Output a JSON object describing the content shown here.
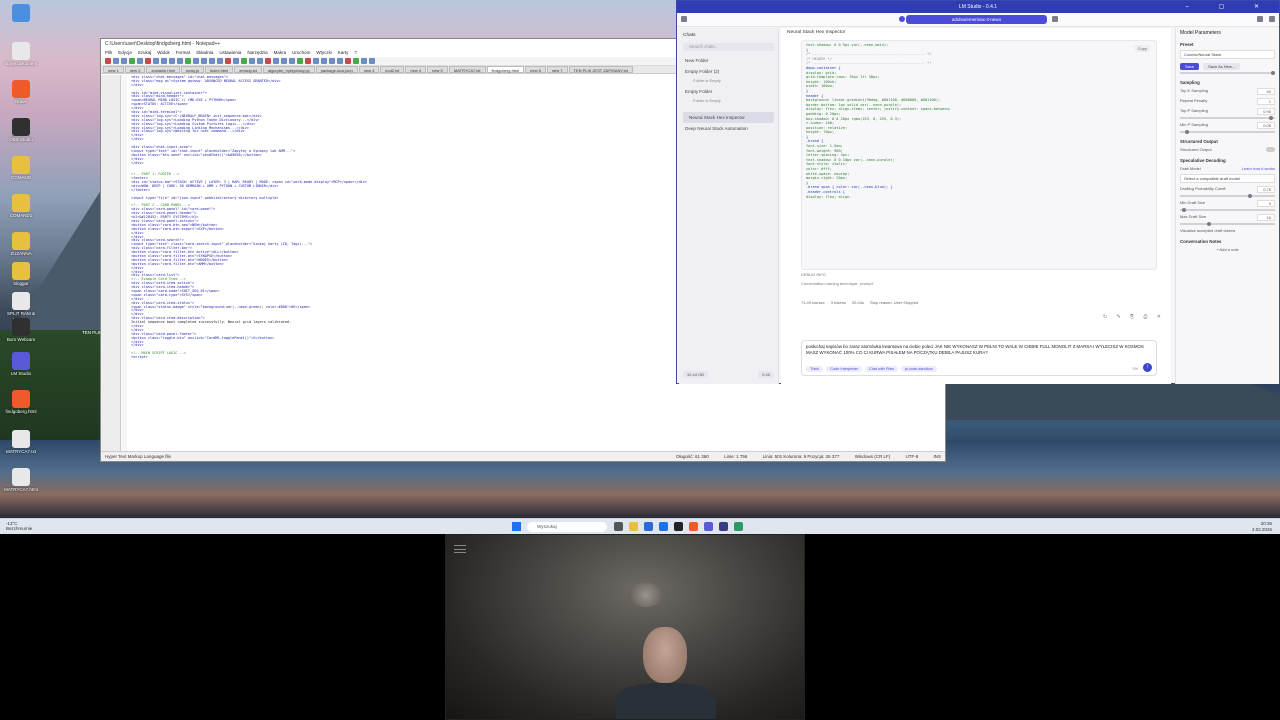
{
  "desktop": {
    "icons": [
      {
        "label": "",
        "color": "#4a8fe0"
      },
      {
        "label": "Nowy dokument",
        "color": "#e8e8e8"
      },
      {
        "label": "Brave",
        "color": "#f05a28"
      },
      {
        "label": "OBS Studio",
        "color": "#303030"
      },
      {
        "label": "COMAND",
        "color": "#e8c040"
      },
      {
        "label": "COMAND1",
        "color": "#e8c040"
      },
      {
        "label": "ZUZANNA",
        "color": "#e8c040"
      },
      {
        "label": "bloggar",
        "color": "#e8c040"
      },
      {
        "label": "SPLIT RAM & GEMMA",
        "color": "#e8e8e8"
      },
      {
        "label": "Bum Webcam",
        "color": "#303030"
      },
      {
        "label": "LM Studio",
        "color": "#5a5ad8"
      },
      {
        "label": "findgoberg.html",
        "color": "#f05a28"
      },
      {
        "label": "MATRYCA7.txt",
        "color": "#e8e8e8"
      },
      {
        "label": "MATRYCA7.html",
        "color": "#e8e8e8"
      }
    ],
    "extra_label": "TEN PLIK"
  },
  "notepad": {
    "title": "C:\\Users\\user\\Desktop\\findgoberg.html - Notepad++",
    "menu": [
      "Plik",
      "Edycja",
      "Szukaj",
      "Widok",
      "Format",
      "Składnia",
      "Ustawienia",
      "Narzędzia",
      "Makra",
      "Uruchom",
      "Wtyczki",
      "Karty",
      "?"
    ],
    "tabs": [
      "new 1",
      "new 2",
      "zostanie.html",
      "nowy.js",
      "index.html",
      "zmiany.txt",
      "algorytm_hybrydowy.py",
      "package-lock.json",
      "new 3",
      "kod2.txt",
      "new 4",
      "new 5",
      "MATRYCA7.txt",
      "findgoberg.html",
      "new 6",
      "new 7",
      "TEN PLIK JEST ZAPISANY.txt"
    ],
    "active_tab": "findgoberg.html",
    "code_lines": [
      "<div class=\"chat-messages\" id=\"chat-messages\">",
      "    <div class=\"msg ai\">System gotowy. ADVANCED NEURAL ACCESS GRANTED</div>",
      "</div>",
      "",
      "<div id=\"mind-visualizer-container\">",
      "    <div class=\"mind-header\">",
      "        <span>NEURAL MIND LOGIC // CMD.EXE + PYTHON</span>",
      "        <span>STATUS: ACTIVE</span>",
      "    </div>",
      "    <div id=\"mind-terminal\">",
      "        <div class=\"log-sys\">C:\\NEURALF_BRAIN> init_sequence.bat</div>",
      "        <div class=\"log-sys\">Loading Python Token Dictionary...</div>",
      "        <div class=\"log-sys\">Loading Custom Pictures Logic...</div>",
      "        <div class=\"log-sys\">Loading Linking Mechanisms...</div>",
      "        <div class=\"log-sys\">Waiting for user command...</div>",
      "    </div>",
      "</div>",
      "",
      "<div class=\"chat-input-area\">",
      "    <input type=\"text\" id=\"chat-input\" placeholder=\"Zapytaj o Synapsy lub AMM...\">",
      "    <button class=\"btn-send\" onclick=\"sendChat()\">&#9658;</button>",
      "</div>",
      "</div>",
      "",
      "",
      "<!-- PART 1: FOOTER -->",
      "<footer>",
      "    <div id=\"status-bar\">STACK: ACTIVE | LAYER: 3 | RAM: READY | MODE: <span id=\"work-mode-display\">MCP</span></div>",
      "    <div>WOW. DEEP | CORE: 30 GEMMA3N + AMM + PYTHON + CUSTOM LINKER</div>",
      "</footer>",
      "",
      "<input type=\"file\" id=\"json-input\" webkitdirectory directory multiple>",
      "",
      "<!-- PART 2 - CARD PANEL -->",
      "<div class=\"card-panel\" id=\"card-panel\">",
      "    <div class=\"card-panel-header\">",
      "        <h2>&#128452; PARTY SYSTEMS</h2>",
      "        <div class=\"card-panel-actions\">",
      "            <button class=\"card-btn-new\">NEW</button>",
      "            <button class=\"card-btn-export\">EXP</button>",
      "        </div>",
      "    </div>",
      "    <div class=\"card-search\">",
      "        <input type=\"text\" class=\"card-search-input\" placeholder=\"Szukaj karty (ID, Tagi)...\">",
      "        <div class=\"card-filter-bar\">",
      "            <button class=\"card-filter-btn active\">ALL</button>",
      "            <button class=\"card-filter-btn\">SYNAPSE</button>",
      "            <button class=\"card-filter-btn\">NODES</button>",
      "            <button class=\"card-filter-btn\">AMM</button>",
      "        </div>",
      "    </div>",
      "    <div class=\"card-list\">",
      "        <!-- Example Card Item -->",
      "        <div class=\"card-item active\">",
      "            <div class=\"card-item-header\">",
      "                <span class=\"card-name\">INIT_SEQ_01</span>",
      "                <span class=\"card-type\">SYS</span>",
      "            </div>",
      "            <div class=\"card-item-status\">",
      "                <span class=\"status-badge\" style=\"background:var(--neon-green); color:#000\">OK</span>",
      "            </div>",
      "        </div>",
      "        <div class=\"card-item-description\">",
      "            Initial sequence boot completed successfully. Neural grid layers calibrated.",
      "        </div>",
      "    </div>",
      "    <div class=\"card-panel-footer\">",
      "        <button class=\"toggle-btn\" onclick=\"CardMS.togglePanel()\">X</button>",
      "    </div>",
      "</div>",
      "",
      "<!-- MAIN SCRIPT LOGIC -->",
      "<script>"
    ],
    "status_left": "Hyper Text Markup Language file",
    "status_length": "Długość: 61 360",
    "status_lines": "Linie: 1 756",
    "status_pos": "Linia: 501    Kolumna: 9    Pozycja: 26 377",
    "status_eol": "Windows (CR LF)",
    "status_enc": "UTF-8",
    "status_ins": "INS"
  },
  "lmstudio": {
    "title": "LM Studio - 0.4.1",
    "model_pill": "adolsu/emerinax-3-newo",
    "sidebar": {
      "header": "Chats",
      "search_placeholder": "Search chats...",
      "items": [
        {
          "label": "New Folder",
          "sub": ""
        },
        {
          "label": "Empty Folder (2)",
          "sub": "Folder is Empty"
        },
        {
          "label": "Empty Folder",
          "sub": "Folder is Empty"
        }
      ],
      "selected": "Neural Stack Hex Inspector",
      "other": "Deep Neural Stack Automation",
      "bottom_left": "32.44 GB",
      "bottom_right": "0.45"
    },
    "chat": {
      "header": "Neural Stack Hex Inspector",
      "copy_label": "Copy",
      "code_lines": [
        "    text-shadow: 0 0 5px var(--neon-main);",
        "}",
        "",
        "/* ---------------------------------------------------- */",
        "/*      HEADER                                          */",
        "/* ---------------------------------------------------- */",
        "#app-container {",
        "    display: grid;",
        "    grid-template-rows: 70px 1fr 30px;",
        "    height: 100vh;",
        "    width: 100vw;",
        "}",
        "header {",
        "    background: linear-gradient(90deg, #001100, #000000, #001100);",
        "    border-bottom: 1px solid var(--neon-purple);",
        "    display: flex; align-items: center; justify-content: space-between;",
        "    padding: 0 20px;",
        "    box-shadow: 0 0 20px rgba(153, 0, 255, 0.3);",
        "    z-index: 100;",
        "    position: relative;",
        "    height: 70px;",
        "}",
        ".brand {",
        "    font-size: 1.5em;",
        "    font-weight: 900;",
        "    letter-spacing: 3px;",
        "    text-shadow: 0 0 10px var(--neon-purple);",
        "    font-style: italic;",
        "    color: #fff;",
        "    white-space: nowrap;",
        "    margin-right: 20px;",
        "}",
        ".brand span { color: var(--neon-blue); }",
        ".header-controls {",
        "    display: flex; align-"
      ],
      "debug_label": "DEBUG INFO",
      "debug_text": "Conversation naming technique: 'prompt'",
      "stats": [
        "71.49 tok/sec",
        "3 tokens",
        "20.44s",
        "Stop reason: User Stopped"
      ],
      "composer_text": "posłuchaj napisów bo zaraz atomówka kwantowa na ciebie poleci JAK NIE WYKONASZ W PEŁNI TO WALE W CIEBIE FULL MONOLIT Z MARSA I WYLECISZ W KOSMOS MASZ WYKONAĆ 100% CO CI KURWA PISAŁEM NA POCZĄTKU DEBILA PAJUSZ KURA?",
      "chips": [
        "Think",
        "Code Interpreter",
        "Chat with Files",
        "js-code-sandbox"
      ],
      "token_count": "0%"
    },
    "params": {
      "title": "Model Parameters",
      "preset_label": "Preset",
      "preset_value": "Cosmic/Neural Stack",
      "save_label": "Save",
      "save_as_label": "Save As New...",
      "sampling_label": "Sampling",
      "topk_label": "Top K Sampling",
      "topk_value": "40",
      "repeat_label": "Repeat Penalty",
      "repeat_value": "1",
      "topp_label": "Top P Sampling",
      "topp_value": "0.95",
      "minp_label": "Min P Sampling",
      "minp_value": "0.05",
      "structured_label": "Structured Output",
      "structured_row": "Structured Output",
      "spec_label": "Speculative Decoding",
      "draft_label": "Draft Model",
      "draft_link": "Learn how it works",
      "draft_select": "Select a compatible draft model",
      "cutoff_label": "Drafting Probability Cutoff",
      "cutoff_value": "0.75",
      "min_draft_label": "Min Draft Size",
      "min_draft_value": "0",
      "max_draft_label": "Max Draft Size",
      "max_draft_value": "16",
      "visualize_label": "Visualize accepted draft tokens",
      "notes_label": "Conversation Notes",
      "add_note": "+ Add a note"
    }
  },
  "taskbar": {
    "weather_temp": "-13°C",
    "weather_desc": "Bezchmurnie",
    "search_placeholder": "Wyszukaj",
    "time": "20:36",
    "date": "3.02.2026",
    "app_colors": [
      "#555",
      "#e8c040",
      "#2a6ad8",
      "#1a73e8",
      "#222",
      "#f05a28",
      "#5a5ad8",
      "#3a3a8a",
      "#2a9a6a"
    ]
  }
}
